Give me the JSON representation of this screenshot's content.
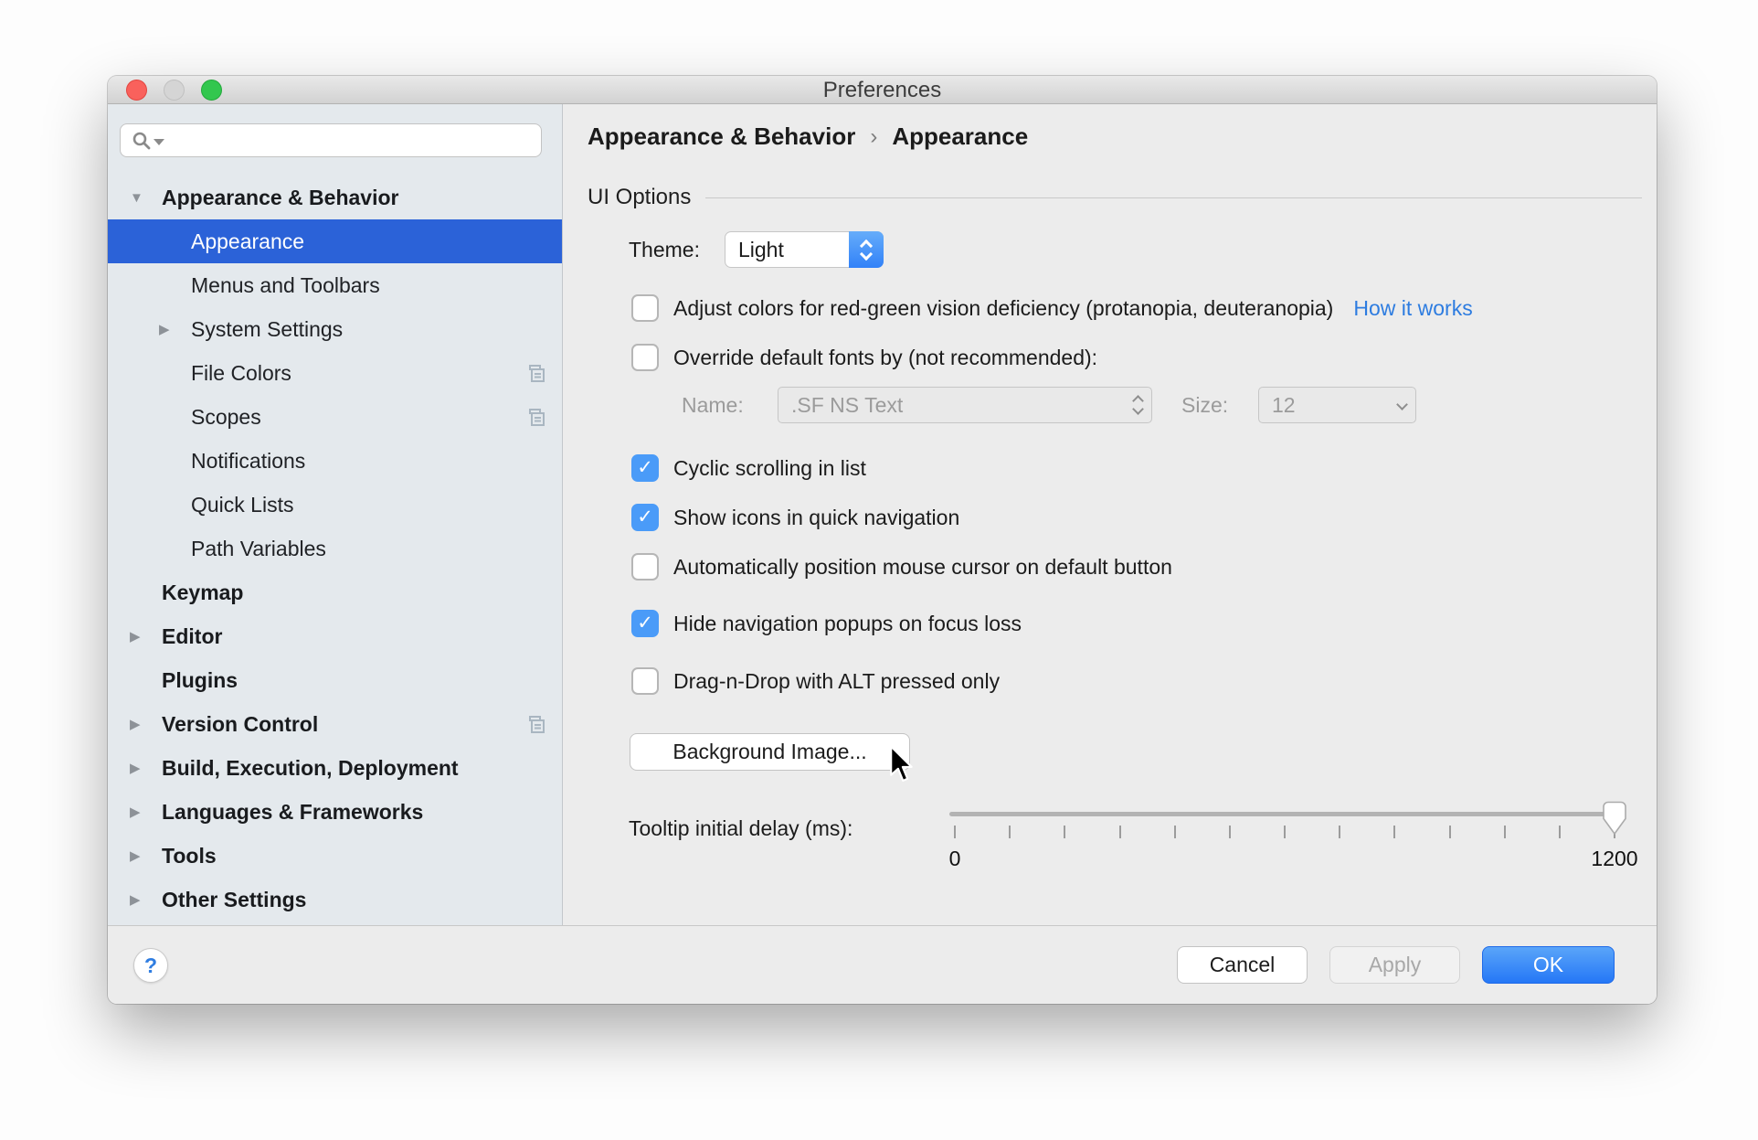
{
  "colors": {
    "selection-blue": "#2b62d8",
    "checkbox-blue": "#4a9bf8",
    "link-blue": "#2d7ce0",
    "ok-top": "#5aa5f9",
    "ok-bottom": "#2577f6",
    "stepper-top": "#66adfa",
    "stepper-bottom": "#3181f8"
  },
  "window": {
    "title": "Preferences"
  },
  "sidebar": {
    "search": {
      "value": "",
      "placeholder": ""
    },
    "items": [
      {
        "label": "Appearance & Behavior",
        "level": 0,
        "bold": true,
        "arrow": "down",
        "selected": false,
        "copy_icon": false
      },
      {
        "label": "Appearance",
        "level": 1,
        "bold": false,
        "arrow": "none",
        "selected": true,
        "copy_icon": false
      },
      {
        "label": "Menus and Toolbars",
        "level": 1,
        "bold": false,
        "arrow": "none",
        "selected": false,
        "copy_icon": false
      },
      {
        "label": "System Settings",
        "level": 1,
        "bold": false,
        "arrow": "right",
        "selected": false,
        "copy_icon": false
      },
      {
        "label": "File Colors",
        "level": 1,
        "bold": false,
        "arrow": "none",
        "selected": false,
        "copy_icon": true
      },
      {
        "label": "Scopes",
        "level": 1,
        "bold": false,
        "arrow": "none",
        "selected": false,
        "copy_icon": true
      },
      {
        "label": "Notifications",
        "level": 1,
        "bold": false,
        "arrow": "none",
        "selected": false,
        "copy_icon": false
      },
      {
        "label": "Quick Lists",
        "level": 1,
        "bold": false,
        "arrow": "none",
        "selected": false,
        "copy_icon": false
      },
      {
        "label": "Path Variables",
        "level": 1,
        "bold": false,
        "arrow": "none",
        "selected": false,
        "copy_icon": false
      },
      {
        "label": "Keymap",
        "level": 0,
        "bold": true,
        "arrow": "none",
        "selected": false,
        "copy_icon": false
      },
      {
        "label": "Editor",
        "level": 0,
        "bold": true,
        "arrow": "right",
        "selected": false,
        "copy_icon": false
      },
      {
        "label": "Plugins",
        "level": 0,
        "bold": true,
        "arrow": "none",
        "selected": false,
        "copy_icon": false
      },
      {
        "label": "Version Control",
        "level": 0,
        "bold": true,
        "arrow": "right",
        "selected": false,
        "copy_icon": true
      },
      {
        "label": "Build, Execution, Deployment",
        "level": 0,
        "bold": true,
        "arrow": "right",
        "selected": false,
        "copy_icon": false
      },
      {
        "label": "Languages & Frameworks",
        "level": 0,
        "bold": true,
        "arrow": "right",
        "selected": false,
        "copy_icon": false
      },
      {
        "label": "Tools",
        "level": 0,
        "bold": true,
        "arrow": "right",
        "selected": false,
        "copy_icon": false
      },
      {
        "label": "Other Settings",
        "level": 0,
        "bold": true,
        "arrow": "right",
        "selected": false,
        "copy_icon": false
      }
    ]
  },
  "breadcrumb": {
    "parent": "Appearance & Behavior",
    "separator": "›",
    "current": "Appearance"
  },
  "main": {
    "section_title": "UI Options",
    "theme_label": "Theme:",
    "theme_value": "Light",
    "link_how_it_works": "How it works",
    "checkboxes": [
      {
        "label": "Adjust colors for red-green vision deficiency (protanopia, deuteranopia)",
        "checked": false
      },
      {
        "label": "Override default fonts by (not recommended):",
        "checked": false
      },
      {
        "label": "Cyclic scrolling in list",
        "checked": true
      },
      {
        "label": "Show icons in quick navigation",
        "checked": true
      },
      {
        "label": "Automatically position mouse cursor on default button",
        "checked": false
      },
      {
        "label": "Hide navigation popups on focus loss",
        "checked": true
      },
      {
        "label": "Drag-n-Drop with ALT pressed only",
        "checked": false
      }
    ],
    "fonts": {
      "name_label": "Name:",
      "name_value": ".SF NS Text",
      "size_label": "Size:",
      "size_value": "12"
    },
    "background_button": "Background Image...",
    "tooltip": {
      "label": "Tooltip initial delay (ms):",
      "min_label": "0",
      "max_label": "1200",
      "min": 0,
      "max": 1200,
      "value": 1200,
      "tick_count": 13
    }
  },
  "footer": {
    "help_label": "?",
    "cancel": "Cancel",
    "apply": "Apply",
    "ok": "OK"
  }
}
